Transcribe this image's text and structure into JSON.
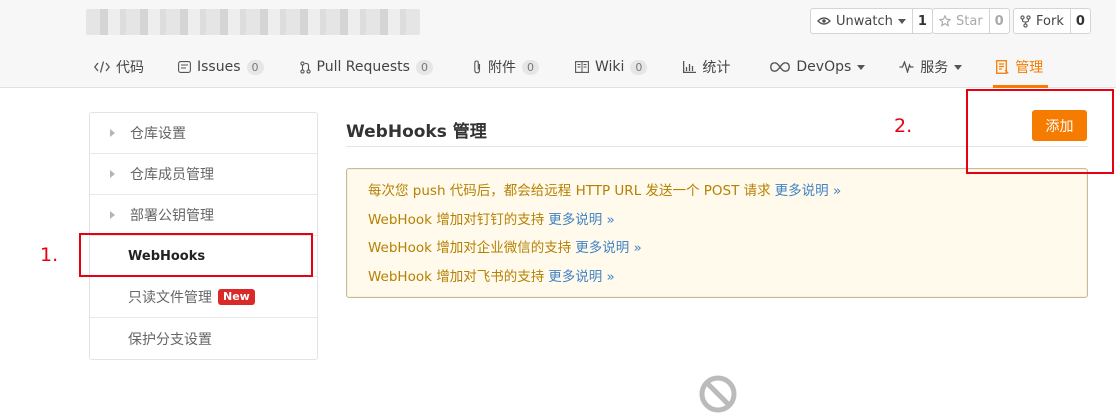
{
  "header": {
    "social": {
      "watch": {
        "label": "Unwatch",
        "count": "1"
      },
      "star": {
        "label": "Star",
        "count": "0"
      },
      "fork": {
        "label": "Fork",
        "count": "0"
      }
    }
  },
  "tabs": [
    {
      "label": "代码",
      "icon": "code-icon"
    },
    {
      "label": "Issues",
      "badge": "0",
      "icon": "issue-icon"
    },
    {
      "label": "Pull Requests",
      "badge": "0",
      "icon": "pull-request-icon"
    },
    {
      "label": "附件",
      "badge": "0",
      "icon": "paperclip-icon"
    },
    {
      "label": "Wiki",
      "badge": "0",
      "icon": "book-icon"
    },
    {
      "label": "统计",
      "icon": "bar-chart-icon"
    },
    {
      "label": "DevOps",
      "icon": "infinity-icon"
    },
    {
      "label": "服务",
      "icon": "pulse-icon"
    },
    {
      "label": "管理",
      "icon": "manage-icon",
      "active": true
    }
  ],
  "sidebar": {
    "items": [
      {
        "label": "仓库设置"
      },
      {
        "label": "仓库成员管理"
      },
      {
        "label": "部署公钥管理"
      },
      {
        "label": "WebHooks"
      },
      {
        "label": "只读文件管理",
        "tag": "New"
      },
      {
        "label": "保护分支设置"
      }
    ]
  },
  "main": {
    "title": "WebHooks 管理",
    "add_label": "添加",
    "notice": [
      {
        "text": "每次您 push 代码后，都会给远程 HTTP URL 发送一个 POST 请求",
        "link": "更多说明 »"
      },
      {
        "text": "WebHook 增加对钉钉的支持",
        "link": "更多说明 »"
      },
      {
        "text": "WebHook 增加对企业微信的支持",
        "link": "更多说明 »"
      },
      {
        "text": "WebHook 增加对飞书的支持",
        "link": "更多说明 »"
      }
    ]
  },
  "annotations": {
    "step1": "1.",
    "step2": "2."
  },
  "colors": {
    "accent": "#f57c00",
    "annotation": "#e60012",
    "notice_text": "#b58105",
    "link": "#4183c4"
  }
}
